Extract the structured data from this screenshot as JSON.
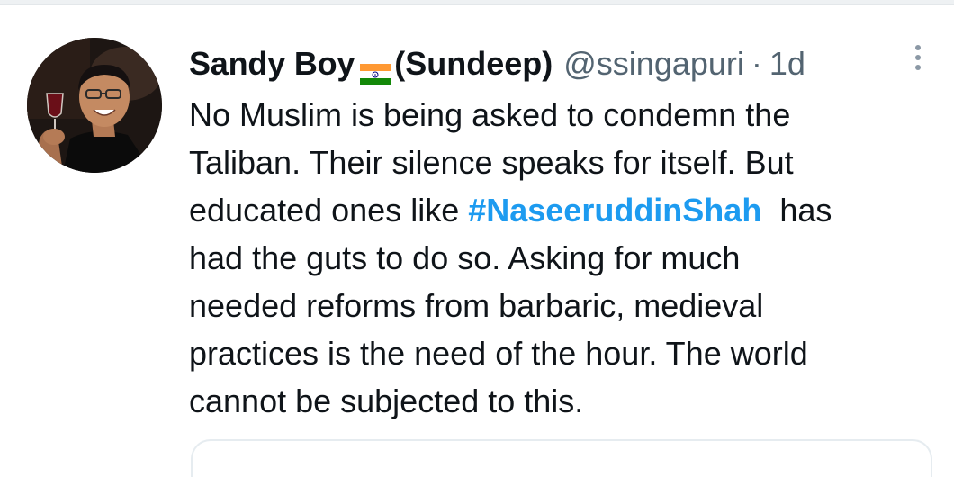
{
  "tweet": {
    "display_name": "Sandy Boy",
    "display_name_suffix": "(Sundeep)",
    "flag_icon": "india-flag-icon",
    "handle": "@ssingapuri",
    "separator": "·",
    "time": "1d",
    "more_icon": "more-vertical-icon",
    "avatar": "profile-avatar",
    "body": {
      "line1": "No Muslim is being asked to condemn the",
      "line2": "Taliban. Their silence speaks for itself. But",
      "line3_before": "educated ones like ",
      "hashtag": "#NaseeruddinShah",
      "line3_after": "  has",
      "line4": "had the guts to do so. Asking for much",
      "line5": "needed reforms from barbaric, medieval",
      "line6": "practices is the need of the hour. The world",
      "line7": "cannot be subjected to this."
    }
  },
  "colors": {
    "text": "#0f1419",
    "secondary": "#536471",
    "link": "#1d9bf0",
    "flag_saffron": "#ff9933",
    "flag_green": "#138808",
    "flag_chakra": "#000080"
  }
}
